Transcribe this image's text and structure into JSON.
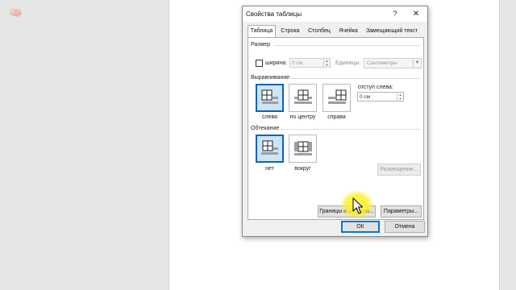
{
  "dialog": {
    "title": "Свойства таблицы",
    "help_glyph": "?",
    "close_glyph": "✕"
  },
  "tabs": [
    {
      "label": "Таблица",
      "active": true
    },
    {
      "label": "Строка",
      "active": false
    },
    {
      "label": "Столбец",
      "active": false
    },
    {
      "label": "Ячейка",
      "active": false
    },
    {
      "label": "Замещающий текст",
      "active": false
    }
  ],
  "size": {
    "section_label": "Размер",
    "width_label": "ширина:",
    "width_checked": false,
    "width_value": "0 см",
    "units_label": "Единицы:",
    "units_value": "Сантиметры"
  },
  "alignment": {
    "section_label": "Выравнивание",
    "indent_label": "отступ слева:",
    "indent_value": "0 см",
    "options": [
      {
        "label": "слева",
        "selected": true
      },
      {
        "label": "по центру",
        "selected": false
      },
      {
        "label": "справа",
        "selected": false
      }
    ]
  },
  "wrapping": {
    "section_label": "Обтекание",
    "options": [
      {
        "label": "нет",
        "selected": true
      },
      {
        "label": "вокруг",
        "selected": false
      }
    ],
    "positioning_button": "Размещение..."
  },
  "buttons": {
    "borders": "Границы и заливка...",
    "options": "Параметры...",
    "ok": "ОК",
    "cancel": "Отмена"
  },
  "icons": {
    "alignment_left": "table-align-left-icon",
    "alignment_center": "table-align-center-icon",
    "alignment_right": "table-align-right-icon",
    "wrap_none": "table-wrap-none-icon",
    "wrap_around": "table-wrap-around-icon"
  },
  "colors": {
    "selection_fill": "#cce4f7",
    "selection_border": "#0a64b4",
    "click_highlight": "#fff23c"
  }
}
